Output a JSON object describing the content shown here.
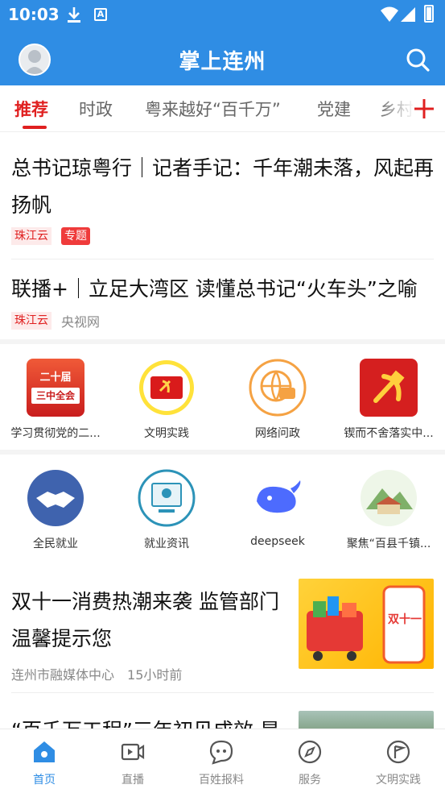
{
  "status": {
    "time": "10:03",
    "keyboard_badge": "A"
  },
  "header": {
    "title": "掌上连州"
  },
  "tabs": [
    {
      "label": "推荐",
      "active": true
    },
    {
      "label": "时政"
    },
    {
      "label": "粤来越好“百千万”"
    },
    {
      "label": "党建"
    },
    {
      "label": "乡村"
    }
  ],
  "articles": [
    {
      "title": "总书记琼粤行｜记者手记：千年潮未落，风起再扬帆",
      "tags": [
        "珠江云",
        "专题"
      ]
    },
    {
      "title": "联播+｜立足大湾区 读懂总书记“火车头”之喻",
      "tag": "珠江云",
      "source": "央视网"
    }
  ],
  "services_row1": [
    {
      "label": "学习贯彻党的二...",
      "icon": "congress-badge-icon",
      "badge_line1": "二十届",
      "badge_line2": "三中全会"
    },
    {
      "label": "文明实践",
      "icon": "party-flag-icon"
    },
    {
      "label": "网络问政",
      "icon": "globe-chat-icon"
    },
    {
      "label": "锲而不舍落实中...",
      "icon": "party-emblem-icon"
    }
  ],
  "services_row2": [
    {
      "label": "全民就业",
      "icon": "handshake-icon"
    },
    {
      "label": "就业资讯",
      "icon": "job-info-icon"
    },
    {
      "label": "deepseek",
      "icon": "whale-icon"
    },
    {
      "label": "聚焦“百县千镇...",
      "icon": "village-icon"
    }
  ],
  "image_articles": [
    {
      "title": "双十一消费热潮来袭 监管部门温馨提示您",
      "source": "连州市融媒体中心",
      "time": "15小时前",
      "thumb_text": "双十一"
    },
    {
      "title": "“百千万工程”三年初见成效 是"
    }
  ],
  "bottom_nav": [
    {
      "label": "首页",
      "icon": "home-icon",
      "active": true
    },
    {
      "label": "直播",
      "icon": "video-icon"
    },
    {
      "label": "百姓报料",
      "icon": "chat-bubble-icon"
    },
    {
      "label": "服务",
      "icon": "compass-icon"
    },
    {
      "label": "文明实践",
      "icon": "flag-circle-icon"
    }
  ],
  "colors": {
    "brand_blue": "#2f8de4",
    "accent_red": "#e02020"
  }
}
